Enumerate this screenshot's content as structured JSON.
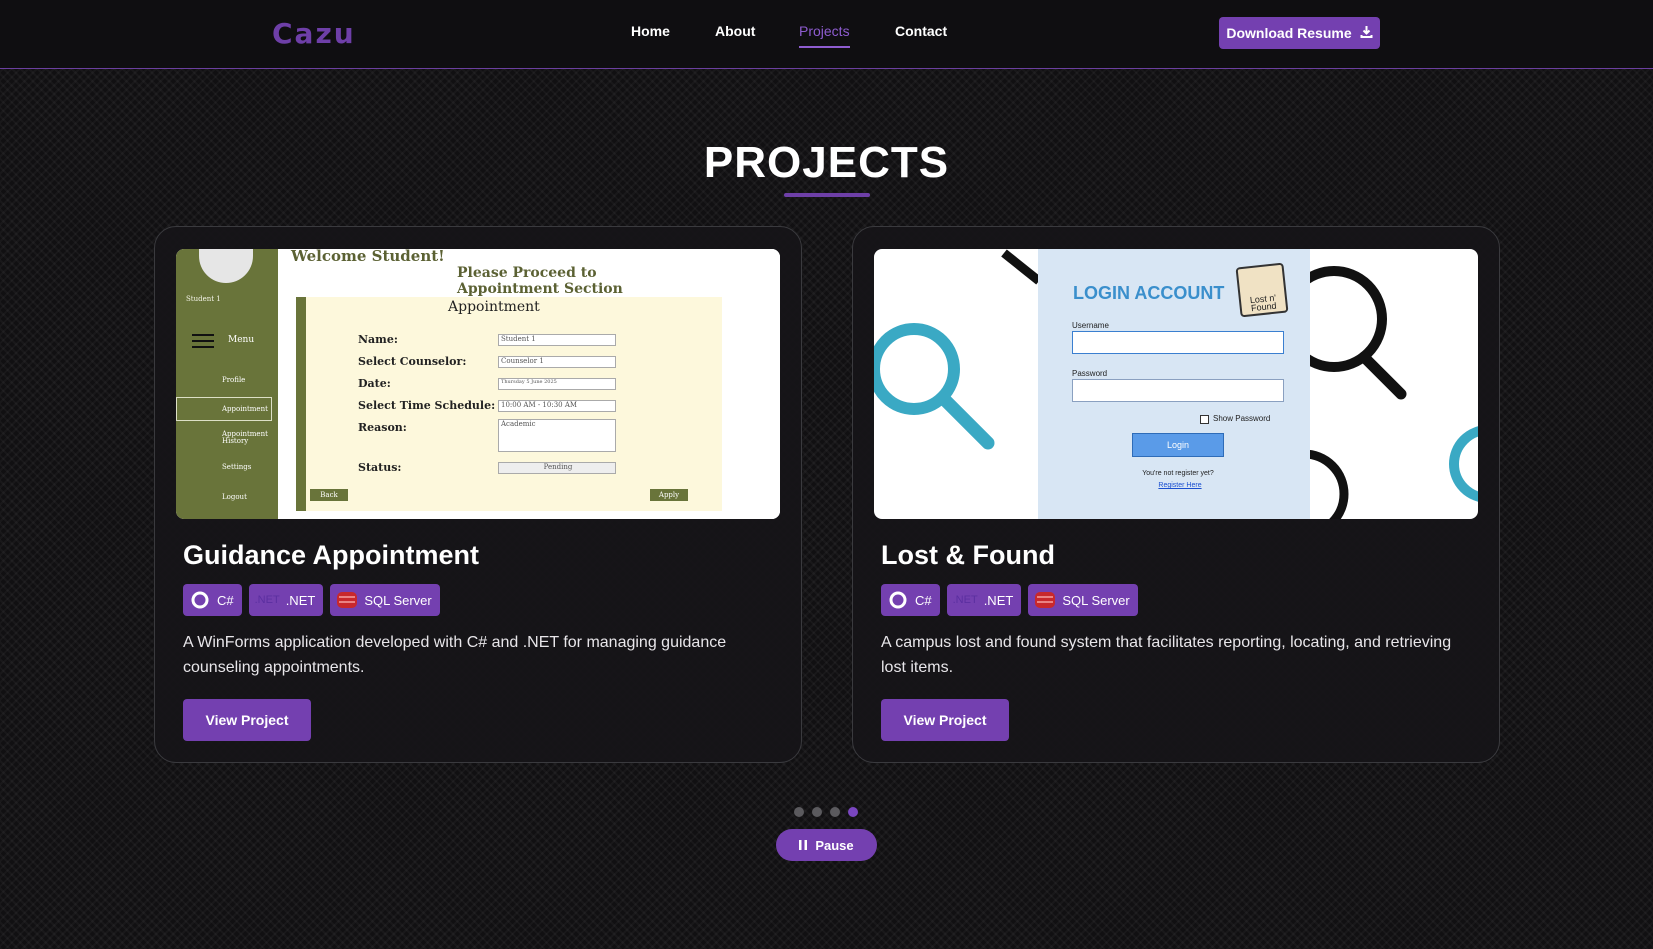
{
  "nav": {
    "logo": "Cazu",
    "links": [
      "Home",
      "About",
      "Projects",
      "Contact"
    ],
    "active": "Projects",
    "resume_label": "Download Resume"
  },
  "section": {
    "title": "PROJECTS"
  },
  "projects": [
    {
      "title": "Guidance Appointment",
      "tags": [
        {
          "icon": "csharp-icon",
          "label": "C#"
        },
        {
          "icon": "dotnet-icon",
          "icon_text": ".NET",
          "label": ".NET"
        },
        {
          "icon": "sql-server-icon",
          "label": "SQL Server"
        }
      ],
      "description": "A WinForms application developed with C# and .NET for managing guidance counseling appointments.",
      "button": "View Project",
      "screenshot": {
        "student": "Student 1",
        "menu": "Menu",
        "side_items": [
          "Profile",
          "Appointment",
          "Appointment History",
          "Settings",
          "Logout"
        ],
        "welcome": "Welcome Student!",
        "heading_line1": "Please Proceed to",
        "heading_line2": "Appointment Section",
        "panel_title": "Appointment",
        "labels": [
          "Name:",
          "Select Counselor:",
          "Date:",
          "Select Time Schedule:",
          "Reason:",
          "Status:"
        ],
        "values": [
          "Student 1",
          "Counselor 1",
          "Thursday    5    June    2025",
          "10:00 AM - 10:30 AM",
          "Academic",
          "Pending"
        ],
        "back": "Back",
        "apply": "Apply"
      }
    },
    {
      "title": "Lost & Found",
      "tags": [
        {
          "icon": "csharp-icon",
          "label": "C#"
        },
        {
          "icon": "dotnet-icon",
          "icon_text": ".NET",
          "label": ".NET"
        },
        {
          "icon": "sql-server-icon",
          "label": "SQL Server"
        }
      ],
      "description": "A campus lost and found system that facilitates reporting, locating, and retrieving lost items.",
      "button": "View Project",
      "screenshot": {
        "heading": "LOGIN ACCOUNT",
        "badge": "Lost n' Found",
        "username_label": "Username",
        "password_label": "Password",
        "show_password": "Show Password",
        "login": "Login",
        "register_prompt": "You're not register yet?",
        "register_link": "Register Here"
      }
    }
  ],
  "carousel": {
    "dot_count": 4,
    "active_index": 3,
    "pause_label": "Pause"
  },
  "colors": {
    "accent": "#7440b0",
    "logo": "#6e3fa8",
    "background": "#111012"
  }
}
